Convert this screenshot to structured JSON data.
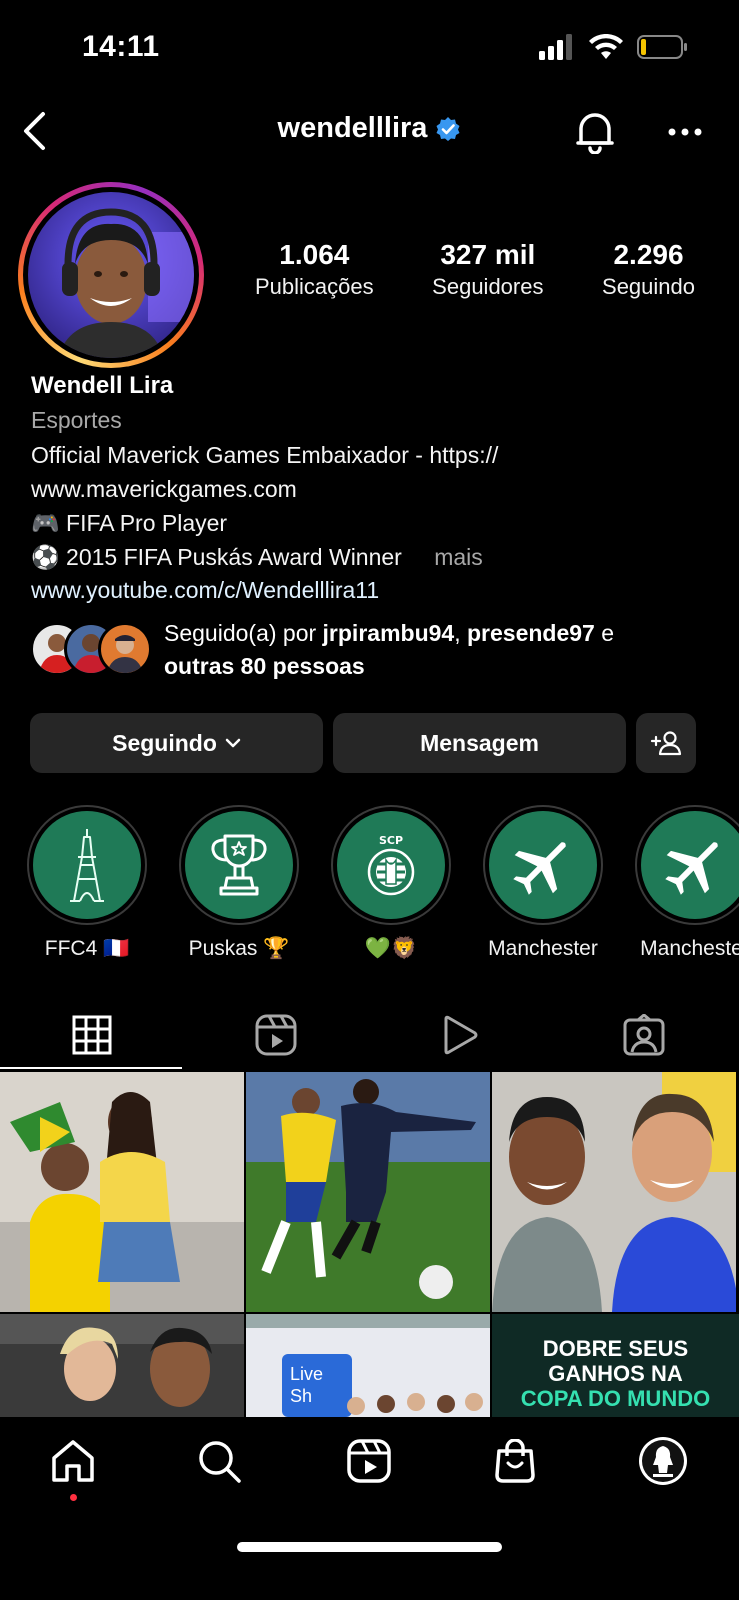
{
  "status_bar": {
    "time": "14:11"
  },
  "header": {
    "username": "wendelllira",
    "verified": true
  },
  "stats": [
    {
      "value": "1.064",
      "label": "Publicações"
    },
    {
      "value": "327 mil",
      "label": "Seguidores"
    },
    {
      "value": "2.296",
      "label": "Seguindo"
    }
  ],
  "bio": {
    "name": "Wendell Lira",
    "category": "Esportes",
    "line1": "Official Maverick Games Embaixador - https://",
    "line2": "www.maverickgames.com",
    "line3_emoji": "🎮",
    "line3": "FIFA Pro Player",
    "line4_emoji": "⚽",
    "line4": "2015 FIFA Puskás Award Winner",
    "more": "mais",
    "link": "www.youtube.com/c/Wendelllira11"
  },
  "followed_by": {
    "prefix": "Seguido(a) por ",
    "user1": "jrpirambu94",
    "sep": ", ",
    "user2": "presende97",
    "conj": " e",
    "others": "outras 80 pessoas"
  },
  "actions": {
    "following_label": "Seguindo",
    "message_label": "Mensagem"
  },
  "highlights": [
    {
      "label": "FFC4 🇫🇷",
      "icon": "eiffel-tower-icon"
    },
    {
      "label": "Puskas 🏆",
      "icon": "trophy-icon"
    },
    {
      "label": "💚🦁",
      "icon": "sporting-crest-icon"
    },
    {
      "label": "Manchester",
      "icon": "airplane-icon"
    },
    {
      "label": "Manchester",
      "icon": "airplane-icon"
    }
  ],
  "tabs": [
    "grid-icon",
    "reels-icon",
    "play-icon",
    "tagged-icon"
  ],
  "grid_posts": [
    {
      "caption": ""
    },
    {
      "caption": ""
    },
    {
      "caption": ""
    },
    {
      "caption": ""
    },
    {
      "caption": ""
    },
    {
      "line1": "DOBRE SEUS",
      "line2": "GANHOS NA",
      "line3": "COPA DO MUNDO"
    }
  ],
  "bottom_nav": [
    "home-icon",
    "search-icon",
    "reels-icon",
    "shop-icon",
    "profile-avatar"
  ],
  "colors": {
    "background": "#000000",
    "button_bg": "#262626",
    "verified": "#3897f0",
    "highlight_green": "#1f7a57",
    "notification_dot": "#ff3040"
  }
}
